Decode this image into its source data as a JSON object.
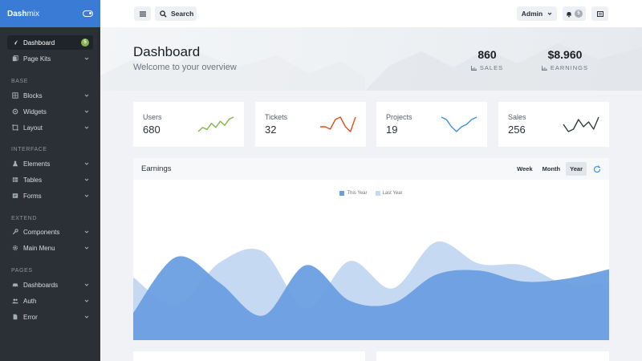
{
  "brand": {
    "bold": "Dash",
    "light": "mix"
  },
  "sidebar": {
    "items": [
      {
        "label": "Dashboard",
        "icon": "rocket-icon",
        "badge": "5",
        "active": true
      },
      {
        "label": "Page Kits",
        "icon": "pages-icon"
      },
      {
        "label": "Blocks",
        "icon": "blocks-icon"
      },
      {
        "label": "Widgets",
        "icon": "widgets-icon"
      },
      {
        "label": "Layout",
        "icon": "layout-icon"
      },
      {
        "label": "Elements",
        "icon": "flask-icon"
      },
      {
        "label": "Tables",
        "icon": "table-icon"
      },
      {
        "label": "Forms",
        "icon": "forms-icon"
      },
      {
        "label": "Components",
        "icon": "wrench-icon"
      },
      {
        "label": "Main Menu",
        "icon": "gear-icon"
      },
      {
        "label": "Dashboards",
        "icon": "car-icon"
      },
      {
        "label": "Auth",
        "icon": "users-icon"
      },
      {
        "label": "Error",
        "icon": "document-icon"
      }
    ],
    "headings": [
      "Base",
      "Interface",
      "Extend",
      "Pages"
    ]
  },
  "topbar": {
    "search_label": "Search",
    "user_label": "Admin",
    "notifications_count": "5"
  },
  "hero": {
    "title": "Dashboard",
    "subtitle": "Welcome to your overview",
    "stats": [
      {
        "value": "860",
        "label": "SALES"
      },
      {
        "value": "$8.960",
        "label": "EARNINGS"
      }
    ]
  },
  "cards": [
    {
      "title": "Users",
      "value": "680",
      "color": "#82b54b",
      "spark": [
        2,
        4,
        3,
        6,
        4,
        7,
        5,
        8,
        9
      ]
    },
    {
      "title": "Tickets",
      "value": "32",
      "color": "#e04f1a",
      "spark": [
        4,
        4,
        3,
        7,
        8,
        4,
        2,
        8
      ]
    },
    {
      "title": "Projects",
      "value": "19",
      "color": "#3c90df",
      "spark": [
        8,
        7,
        4,
        2,
        4,
        5,
        7,
        8
      ]
    },
    {
      "title": "Sales",
      "value": "256",
      "color": "#343a40",
      "spark": [
        6,
        3,
        4,
        8,
        5,
        7,
        4,
        9
      ]
    }
  ],
  "earnings": {
    "title": "Earnings",
    "tabs": [
      "Week",
      "Month",
      "Year"
    ],
    "selected_tab": "Year"
  },
  "chart_data": {
    "type": "area",
    "series": [
      {
        "name": "This Year",
        "color": "#6a9ee2",
        "values": [
          20,
          61,
          42,
          18,
          55,
          29,
          27,
          48,
          51,
          43,
          45,
          52
        ]
      },
      {
        "name": "Last Year",
        "color": "#c6d9f3",
        "values": [
          46,
          26,
          57,
          65,
          23,
          58,
          38,
          72,
          56,
          55,
          41,
          42
        ]
      }
    ],
    "ylim": [
      0,
      100
    ],
    "legend": "top-center",
    "grid": false
  },
  "bottom_blocks": [
    "block-left",
    "block-right"
  ]
}
